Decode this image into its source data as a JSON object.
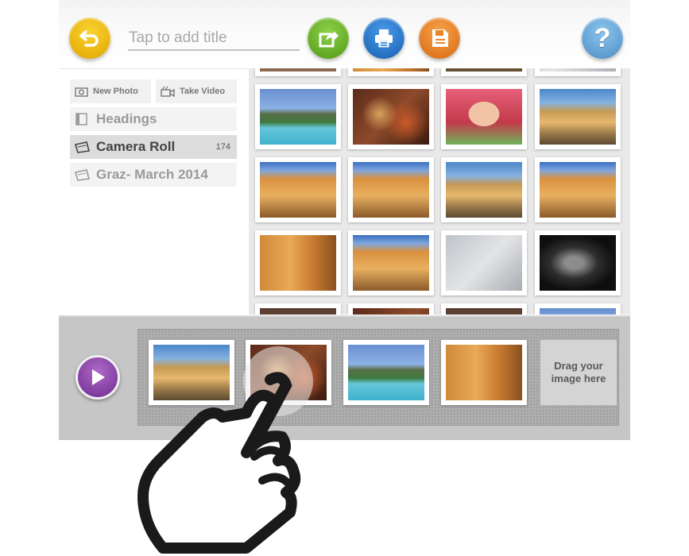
{
  "header": {
    "title_placeholder": "Tap to add title",
    "buttons": {
      "undo_icon": "undo-icon",
      "share_icon": "share-icon",
      "print_icon": "print-icon",
      "save_icon": "save-icon",
      "help_label": "?"
    }
  },
  "sidebar": {
    "new_photo": "New Photo",
    "take_video": "Take Video",
    "items": [
      {
        "label": "Headings",
        "count": ""
      },
      {
        "label": "Camera Roll",
        "count": "174"
      },
      {
        "label": "Graz- March 2014",
        "count": ""
      }
    ]
  },
  "strip": {
    "drag_hint": "Drag your image here"
  },
  "colors": {
    "undo": "#f0c010",
    "share": "#6bb82c",
    "print": "#2d7ad0",
    "save": "#e8862a",
    "help": "#6aaae0",
    "play": "#8a3fb0"
  }
}
